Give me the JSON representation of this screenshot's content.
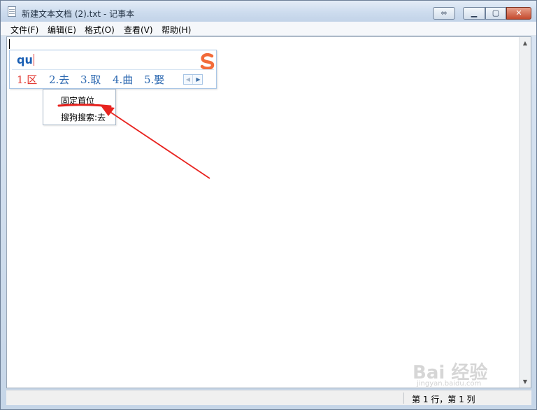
{
  "window": {
    "title": "新建文本文档 (2).txt - 记事本"
  },
  "titlebar_buttons": {
    "restore_alt": "⬄",
    "minimize": "▁",
    "maximize": "▢",
    "close": "✕"
  },
  "menu": [
    {
      "label": "文件(F)"
    },
    {
      "label": "编辑(E)"
    },
    {
      "label": "格式(O)"
    },
    {
      "label": "查看(V)"
    },
    {
      "label": "帮助(H)"
    }
  ],
  "ime": {
    "input": "qu",
    "candidates": [
      "1.区",
      "2.去",
      "3.取",
      "4.曲",
      "5.娶"
    ],
    "prev_page": "◀",
    "next_page": "▶",
    "logo_icon": "sogou-s-logo",
    "logo_color": "#f26b3a"
  },
  "context_menu": {
    "items": [
      "固定首位",
      "搜狗搜索:去"
    ]
  },
  "status": {
    "position": "第 1 行，第 1 列"
  },
  "scroll": {
    "up": "▲",
    "down": "▼"
  },
  "watermark": {
    "text": "Bai 经验",
    "sub": "jingyan.baidu.com"
  },
  "annotation": {
    "color": "#e8231f"
  }
}
